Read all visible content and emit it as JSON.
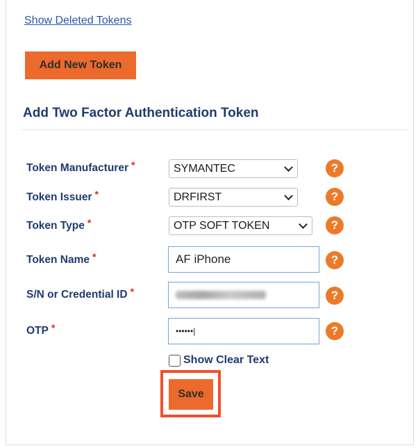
{
  "links": {
    "show_deleted": "Show Deleted Tokens"
  },
  "buttons": {
    "add_new": "Add New Token",
    "save": "Save"
  },
  "section": {
    "title": "Add Two Factor Authentication Token"
  },
  "required_mark": "*",
  "help_glyph": "?",
  "fields": {
    "manufacturer": {
      "label": "Token Manufacturer",
      "value": "SYMANTEC"
    },
    "issuer": {
      "label": "Token Issuer",
      "value": "DRFIRST"
    },
    "type": {
      "label": "Token Type",
      "value": "OTP SOFT TOKEN"
    },
    "name": {
      "label": "Token Name",
      "value": "AF iPhone"
    },
    "serial": {
      "label": "S/N or Credential ID",
      "value": ""
    },
    "otp": {
      "label": "OTP",
      "value": "••••••|"
    }
  },
  "checkbox": {
    "show_clear_text": "Show Clear Text"
  },
  "colors": {
    "accent": "#ec6a2c",
    "label": "#1f3b6e",
    "required": "#e0281b",
    "highlight": "#ef4f2b"
  }
}
